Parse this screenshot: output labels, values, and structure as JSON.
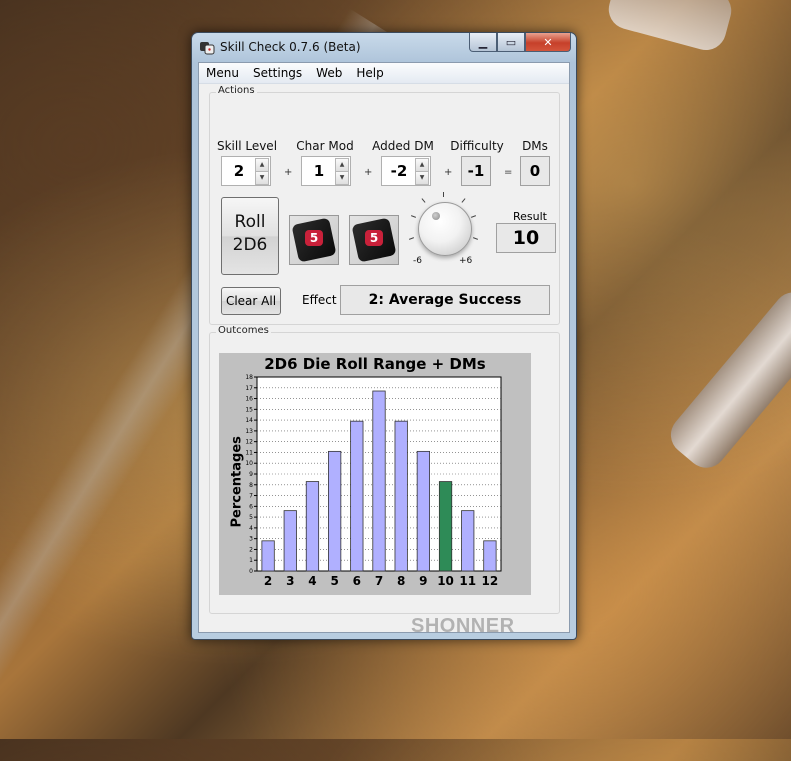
{
  "window": {
    "title": "Skill Check 0.7.6 (Beta)"
  },
  "menu": [
    "Menu",
    "Settings",
    "Web",
    "Help"
  ],
  "actions": {
    "group_label": "Actions",
    "skill_level": {
      "label": "Skill Level",
      "value": "2"
    },
    "char_mod": {
      "label": "Char Mod",
      "value": "1"
    },
    "added_dm": {
      "label": "Added DM",
      "value": "-2"
    },
    "difficulty": {
      "label": "Difficulty",
      "value": "-1"
    },
    "dms": {
      "label": "DMs",
      "value": "0"
    },
    "op_plus": "+",
    "op_equals": "=",
    "roll_button": {
      "line1": "Roll",
      "line2": "2D6"
    },
    "die1_face": "5",
    "die2_face": "5",
    "knob": {
      "min_label": "-6",
      "max_label": "+6"
    },
    "result": {
      "label": "Result",
      "value": "10"
    },
    "clear_button": "Clear All",
    "effect": {
      "label": "Effect",
      "value": "2: Average Success"
    }
  },
  "outcomes": {
    "group_label": "Outcomes"
  },
  "brand": "SHONNER",
  "colors": {
    "bar": "#b0b0ff",
    "highlight": "#2e8b57",
    "chart_bg": "#c0c0c0"
  },
  "chart_data": {
    "type": "bar",
    "title": "2D6 Die Roll Range + DMs",
    "ylabel": "Percentages",
    "xlabel": "",
    "categories": [
      "2",
      "3",
      "4",
      "5",
      "6",
      "7",
      "8",
      "9",
      "10",
      "11",
      "12"
    ],
    "values": [
      2.8,
      5.6,
      8.3,
      11.1,
      13.9,
      16.7,
      13.9,
      11.1,
      8.3,
      5.6,
      2.8
    ],
    "highlight_category": "10",
    "ylim": [
      0,
      18
    ],
    "yticks": [
      0,
      1,
      2,
      3,
      4,
      5,
      6,
      7,
      8,
      9,
      10,
      11,
      12,
      13,
      14,
      15,
      16,
      17,
      18
    ],
    "grid": true
  }
}
